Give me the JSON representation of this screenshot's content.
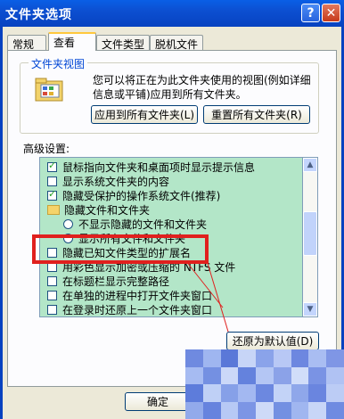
{
  "window": {
    "title": "文件夹选项",
    "help_glyph": "?",
    "close_glyph": "✕"
  },
  "tabs": [
    {
      "label": "常规",
      "active": false
    },
    {
      "label": "查看",
      "active": true
    },
    {
      "label": "文件类型",
      "active": false
    },
    {
      "label": "脱机文件",
      "active": false
    }
  ],
  "folder_views": {
    "group_label": "文件夹视图",
    "description": "您可以将正在为此文件夹使用的视图(例如详细信息或平铺)应用到所有文件夹。",
    "apply_all_label": "应用到所有文件夹(L)",
    "reset_all_label": "重置所有文件夹(R)"
  },
  "advanced": {
    "label": "高级设置:",
    "items": [
      {
        "kind": "checkbox",
        "checked": true,
        "label": "鼠标指向文件夹和桌面项时显示提示信息"
      },
      {
        "kind": "checkbox",
        "checked": false,
        "label": "显示系统文件夹的内容"
      },
      {
        "kind": "checkbox",
        "checked": true,
        "label": "隐藏受保护的操作系统文件(推荐)"
      },
      {
        "kind": "folder",
        "label": "隐藏文件和文件夹"
      },
      {
        "kind": "radio",
        "label": "不显示隐藏的文件和文件夹"
      },
      {
        "kind": "radio",
        "label": "显示所有文件和文件夹"
      },
      {
        "kind": "checkbox",
        "checked": false,
        "label": "隐藏已知文件类型的扩展名"
      },
      {
        "kind": "checkbox",
        "checked": false,
        "label": "用彩色显示加密或压缩的 NTFS 文件"
      },
      {
        "kind": "checkbox",
        "checked": false,
        "label": "在标题栏显示完整路径"
      },
      {
        "kind": "checkbox",
        "checked": false,
        "label": "在单独的进程中打开文件夹窗口"
      },
      {
        "kind": "checkbox",
        "checked": false,
        "label": "在登录时还原上一个文件夹窗口"
      }
    ],
    "restore_defaults_label": "还原为默认值(D)"
  },
  "footer": {
    "ok_label": "确定"
  },
  "colors": {
    "title_bar": "#0c4fd1",
    "list_background": "#b3e6c8",
    "highlight_border": "#e0201e"
  }
}
